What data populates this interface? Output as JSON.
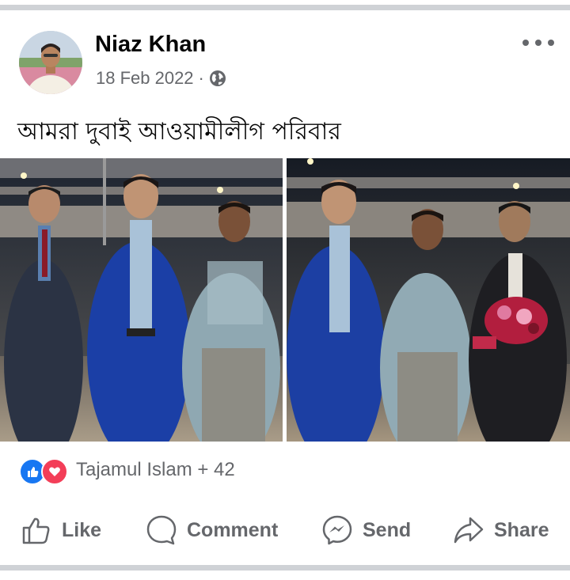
{
  "post": {
    "author": "Niaz Khan",
    "date": "18 Feb 2022",
    "separator": "·",
    "audience_icon": "globe-icon",
    "caption": "আমরা দুবাই আওয়ামীলীগ পরিবার"
  },
  "photos": [
    {
      "alt": "group-photo-left"
    },
    {
      "alt": "group-photo-right"
    }
  ],
  "reactions": {
    "icons": [
      "like-reaction-icon",
      "love-reaction-icon"
    ],
    "summary": "Tajamul Islam + 42"
  },
  "actions": {
    "like": "Like",
    "comment": "Comment",
    "send": "Send",
    "share": "Share"
  },
  "colors": {
    "separator": "#cfd2d6",
    "text_secondary": "#65676b",
    "like_blue": "#1877f2",
    "love_red": "#f33e58"
  }
}
